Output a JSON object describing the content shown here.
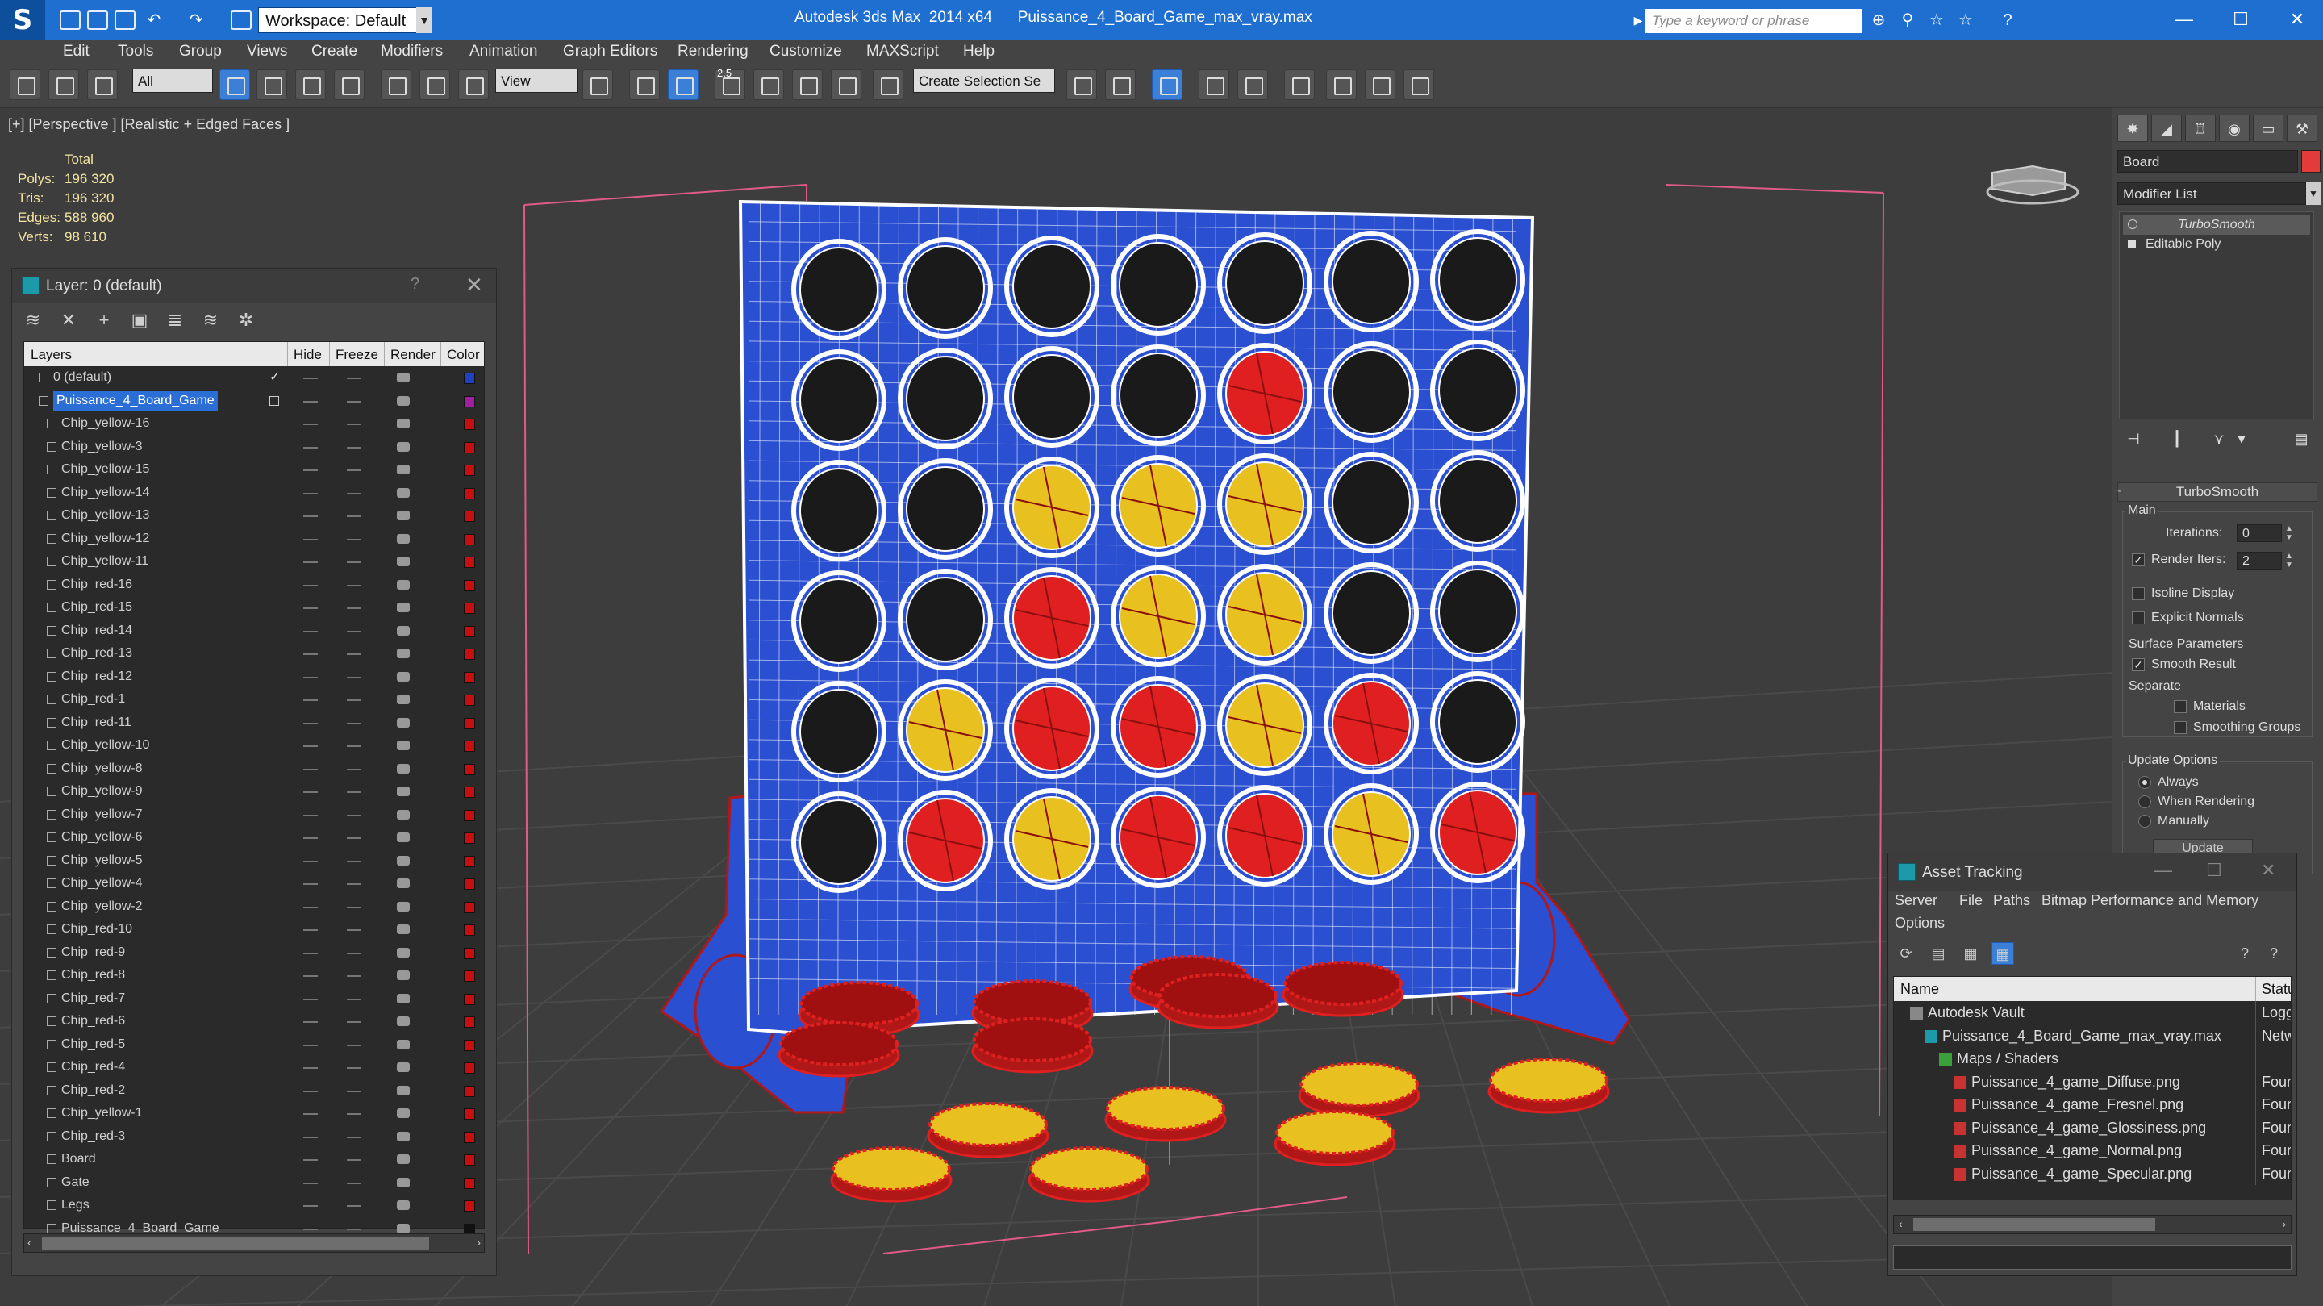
{
  "titlebar": {
    "app_title": "Autodesk 3ds Max  2014 x64      Puissance_4_Board_Game_max_vray.max",
    "workspace_label": "Workspace: Default",
    "search_placeholder": "Type a keyword or phrase",
    "help_glyph": "?",
    "minimize": "—",
    "maximize": "☐",
    "close": "✕"
  },
  "menu": [
    "Edit",
    "Tools",
    "Group",
    "Views",
    "Create",
    "Modifiers",
    "Animation",
    "Graph Editors",
    "Rendering",
    "Customize",
    "MAXScript",
    "Help"
  ],
  "toolbar": {
    "selection_filter": "All",
    "reference_coord": "View",
    "snap_label": "2.5",
    "named_selection": "Create Selection Se"
  },
  "viewport": {
    "label": "[+] [Perspective ] [Realistic + Edged Faces ]",
    "stats": {
      "header": "Total",
      "rows": [
        {
          "label": "Polys:",
          "value": "196 320"
        },
        {
          "label": "Tris:",
          "value": "196 320"
        },
        {
          "label": "Edges:",
          "value": "588 960"
        },
        {
          "label": "Verts:",
          "value": "98 610"
        }
      ]
    }
  },
  "board": {
    "cols": 7,
    "rows": 6,
    "grid": [
      [
        "e",
        "e",
        "e",
        "e",
        "e",
        "e",
        "e"
      ],
      [
        "e",
        "e",
        "e",
        "e",
        "r",
        "e",
        "e"
      ],
      [
        "e",
        "e",
        "y",
        "y",
        "y",
        "e",
        "e"
      ],
      [
        "e",
        "e",
        "r",
        "y",
        "y",
        "e",
        "e"
      ],
      [
        "e",
        "y",
        "r",
        "r",
        "y",
        "r",
        "e"
      ],
      [
        "e",
        "r",
        "y",
        "r",
        "r",
        "y",
        "r"
      ]
    ],
    "colors": {
      "frame": "#2a4fd0",
      "red": "#e02020",
      "yellow": "#e8c020",
      "hole": "#1a1a1a",
      "wire": "#ffffff",
      "leg": "#2a4fd0",
      "leg_wire": "#b01818"
    }
  },
  "layer_panel": {
    "title": "Layer: 0 (default)",
    "help": "?",
    "close": "✕",
    "columns": [
      "Layers",
      "Hide",
      "Freeze",
      "Render",
      "Color"
    ],
    "rows": [
      {
        "name": "0 (default)",
        "level": 0,
        "color": "#2040c0",
        "checked": true
      },
      {
        "name": "Puissance_4_Board_Game",
        "level": 0,
        "color": "#a020a0",
        "selected": true
      },
      {
        "name": "Chip_yellow-16",
        "level": 1,
        "color": "#c41010"
      },
      {
        "name": "Chip_yellow-3",
        "level": 1,
        "color": "#c41010"
      },
      {
        "name": "Chip_yellow-15",
        "level": 1,
        "color": "#c41010"
      },
      {
        "name": "Chip_yellow-14",
        "level": 1,
        "color": "#c41010"
      },
      {
        "name": "Chip_yellow-13",
        "level": 1,
        "color": "#c41010"
      },
      {
        "name": "Chip_yellow-12",
        "level": 1,
        "color": "#c41010"
      },
      {
        "name": "Chip_yellow-11",
        "level": 1,
        "color": "#c41010"
      },
      {
        "name": "Chip_red-16",
        "level": 1,
        "color": "#c41010"
      },
      {
        "name": "Chip_red-15",
        "level": 1,
        "color": "#c41010"
      },
      {
        "name": "Chip_red-14",
        "level": 1,
        "color": "#c41010"
      },
      {
        "name": "Chip_red-13",
        "level": 1,
        "color": "#c41010"
      },
      {
        "name": "Chip_red-12",
        "level": 1,
        "color": "#c41010"
      },
      {
        "name": "Chip_red-1",
        "level": 1,
        "color": "#c41010"
      },
      {
        "name": "Chip_red-11",
        "level": 1,
        "color": "#c41010"
      },
      {
        "name": "Chip_yellow-10",
        "level": 1,
        "color": "#c41010"
      },
      {
        "name": "Chip_yellow-8",
        "level": 1,
        "color": "#c41010"
      },
      {
        "name": "Chip_yellow-9",
        "level": 1,
        "color": "#c41010"
      },
      {
        "name": "Chip_yellow-7",
        "level": 1,
        "color": "#c41010"
      },
      {
        "name": "Chip_yellow-6",
        "level": 1,
        "color": "#c41010"
      },
      {
        "name": "Chip_yellow-5",
        "level": 1,
        "color": "#c41010"
      },
      {
        "name": "Chip_yellow-4",
        "level": 1,
        "color": "#c41010"
      },
      {
        "name": "Chip_yellow-2",
        "level": 1,
        "color": "#c41010"
      },
      {
        "name": "Chip_red-10",
        "level": 1,
        "color": "#c41010"
      },
      {
        "name": "Chip_red-9",
        "level": 1,
        "color": "#c41010"
      },
      {
        "name": "Chip_red-8",
        "level": 1,
        "color": "#c41010"
      },
      {
        "name": "Chip_red-7",
        "level": 1,
        "color": "#c41010"
      },
      {
        "name": "Chip_red-6",
        "level": 1,
        "color": "#c41010"
      },
      {
        "name": "Chip_red-5",
        "level": 1,
        "color": "#c41010"
      },
      {
        "name": "Chip_red-4",
        "level": 1,
        "color": "#c41010"
      },
      {
        "name": "Chip_red-2",
        "level": 1,
        "color": "#c41010"
      },
      {
        "name": "Chip_yellow-1",
        "level": 1,
        "color": "#c41010"
      },
      {
        "name": "Chip_red-3",
        "level": 1,
        "color": "#c41010"
      },
      {
        "name": "Board",
        "level": 1,
        "color": "#c41010"
      },
      {
        "name": "Gate",
        "level": 1,
        "color": "#c41010"
      },
      {
        "name": "Legs",
        "level": 1,
        "color": "#c41010"
      },
      {
        "name": "Puissance_4_Board_Game",
        "level": 1,
        "color": "#111111"
      }
    ]
  },
  "command_panel": {
    "object_name": "Board",
    "modifier_list": "Modifier List",
    "stack": [
      "TurboSmooth",
      "Editable Poly"
    ],
    "rollout_title": "TurboSmooth",
    "main_label": "Main",
    "iterations_label": "Iterations:",
    "iterations_value": "0",
    "render_iters_label": "Render Iters:",
    "render_iters_value": "2",
    "isoline_label": "Isoline Display",
    "explicit_normals_label": "Explicit Normals",
    "surface_params_label": "Surface Parameters",
    "smooth_result_label": "Smooth Result",
    "separate_label": "Separate",
    "materials_label": "Materials",
    "smoothing_groups_label": "Smoothing Groups",
    "update_options_label": "Update Options",
    "always_label": "Always",
    "when_rendering_label": "When Rendering",
    "manually_label": "Manually",
    "update_button": "Update"
  },
  "asset_tracking": {
    "title": "Asset Tracking",
    "menu": [
      "Server",
      "File",
      "Paths",
      "Bitmap Performance and Memory",
      "Options"
    ],
    "columns": [
      "Name",
      "Status"
    ],
    "rows": [
      {
        "name": "Autodesk Vault",
        "status": "Logged O",
        "level": 0,
        "icon": "vault"
      },
      {
        "name": "Puissance_4_Board_Game_max_vray.max",
        "status": "Network",
        "level": 1,
        "icon": "max"
      },
      {
        "name": "Maps / Shaders",
        "status": "",
        "level": 2,
        "icon": "maps"
      },
      {
        "name": "Puissance_4_game_Diffuse.png",
        "status": "Found",
        "level": 3,
        "icon": "png"
      },
      {
        "name": "Puissance_4_game_Fresnel.png",
        "status": "Found",
        "level": 3,
        "icon": "png"
      },
      {
        "name": "Puissance_4_game_Glossiness.png",
        "status": "Found",
        "level": 3,
        "icon": "png"
      },
      {
        "name": "Puissance_4_game_Normal.png",
        "status": "Found",
        "level": 3,
        "icon": "png"
      },
      {
        "name": "Puissance_4_game_Specular.png",
        "status": "Found",
        "level": 3,
        "icon": "png"
      }
    ]
  }
}
